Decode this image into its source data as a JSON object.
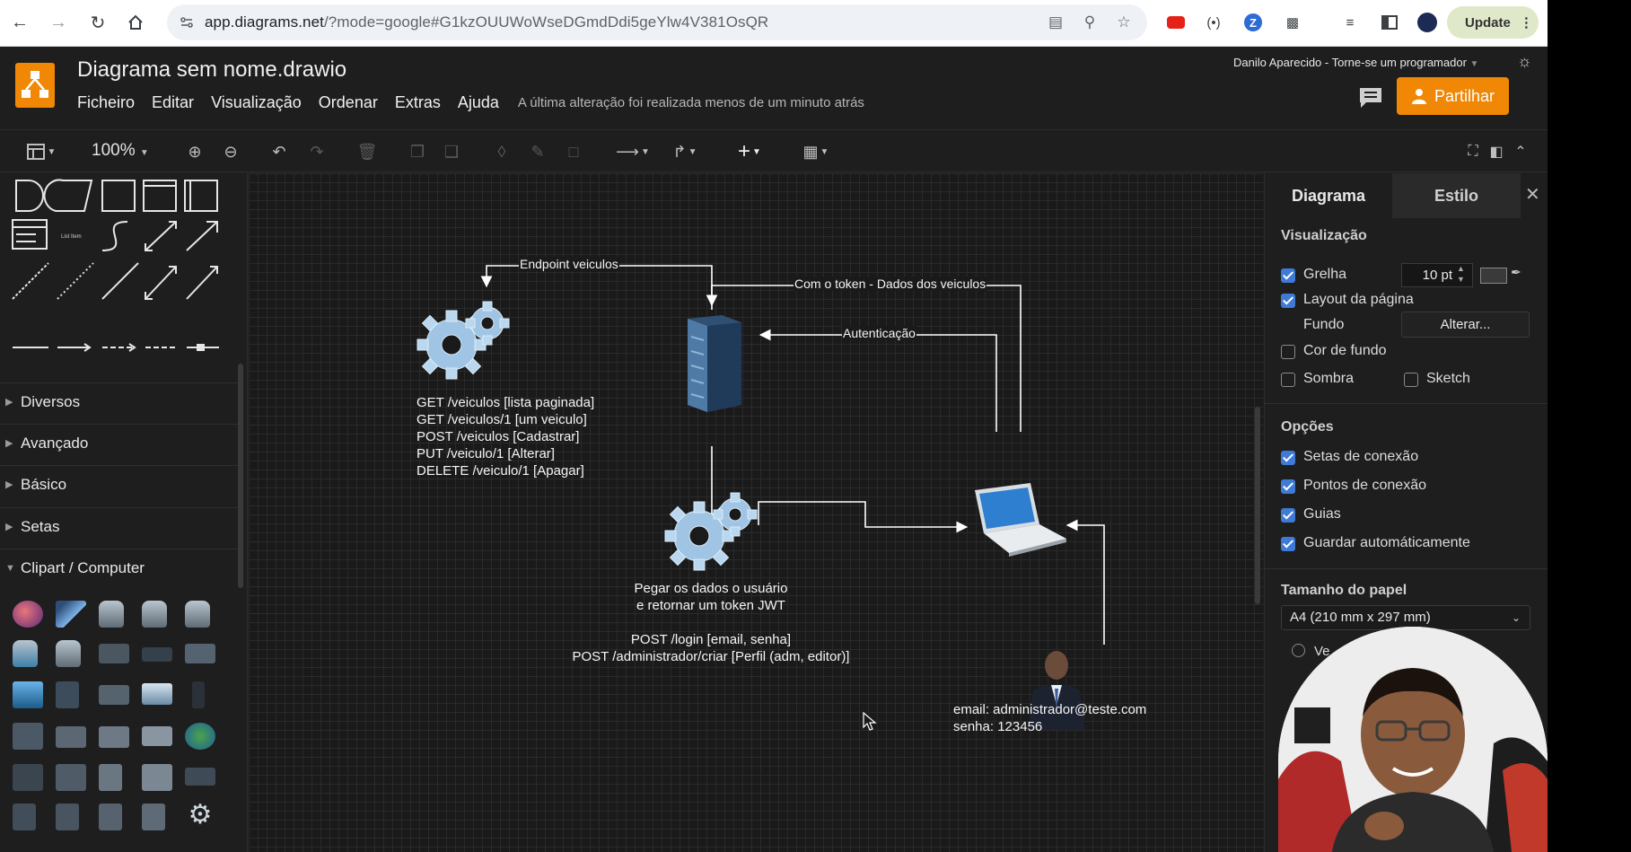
{
  "browser": {
    "url_domain": "app.diagrams.net",
    "url_rest": "/?mode=google#G1kzOUUWoWseDGmdDdi5geYlw4V381OsQR",
    "update_label": "Update"
  },
  "app": {
    "title": "Diagrama sem nome.drawio",
    "menu": [
      "Ficheiro",
      "Editar",
      "Visualização",
      "Ordenar",
      "Extras",
      "Ajuda"
    ],
    "last_saved": "A última alteração foi realizada menos de um minuto atrás",
    "user": "Danilo Aparecido - Torne-se um programador",
    "share_label": "Partilhar",
    "zoom": "100%"
  },
  "sidebar": {
    "sections": [
      "Diversos",
      "Avançado",
      "Básico",
      "Setas",
      "Clipart / Computer"
    ],
    "tiny_label": "List Item"
  },
  "canvas": {
    "edge_labels": {
      "endpoint": "Endpoint veiculos",
      "token": "Com o token - Dados dos veiculos",
      "auth": "Autenticação"
    },
    "api_text": "GET /veiculos [lista paginada]\nGET /veiculos/1 [um veiculo]\nPOST /veiculos [Cadastrar]\nPUT /veiculo/1 [Alterar]\nDELETE /veiculo/1 [Apagar]",
    "auth_text_1": "Pegar os dados o usuário",
    "auth_text_2": "e retornar um token JWT",
    "auth_text_3": "POST /login [email, senha]",
    "auth_text_4": "POST /administrador/criar [Perfil (adm, editor)]",
    "user_text_1": "email: administrador@teste.com",
    "user_text_2": "senha: 123456"
  },
  "panel": {
    "tabs": [
      "Diagrama",
      "Estilo"
    ],
    "view_header": "Visualização",
    "grid_label": "Grelha",
    "grid_size": "10 pt",
    "page_layout_label": "Layout da página",
    "background_label": "Fundo",
    "change_label": "Alterar...",
    "bg_color_label": "Cor de fundo",
    "shadow_label": "Sombra",
    "sketch_label": "Sketch",
    "options_header": "Opções",
    "opt_arrows": "Setas de conexão",
    "opt_points": "Pontos de conexão",
    "opt_guides": "Guias",
    "opt_autosave": "Guardar automáticamente",
    "paper_header": "Tamanho do papel",
    "paper_size": "A4 (210 mm x 297 mm)",
    "orientation_partial": "Ve"
  },
  "colors": {
    "accent": "#f08705",
    "checkbox": "#3f7ad6",
    "canvas": "#1a1a1a"
  }
}
